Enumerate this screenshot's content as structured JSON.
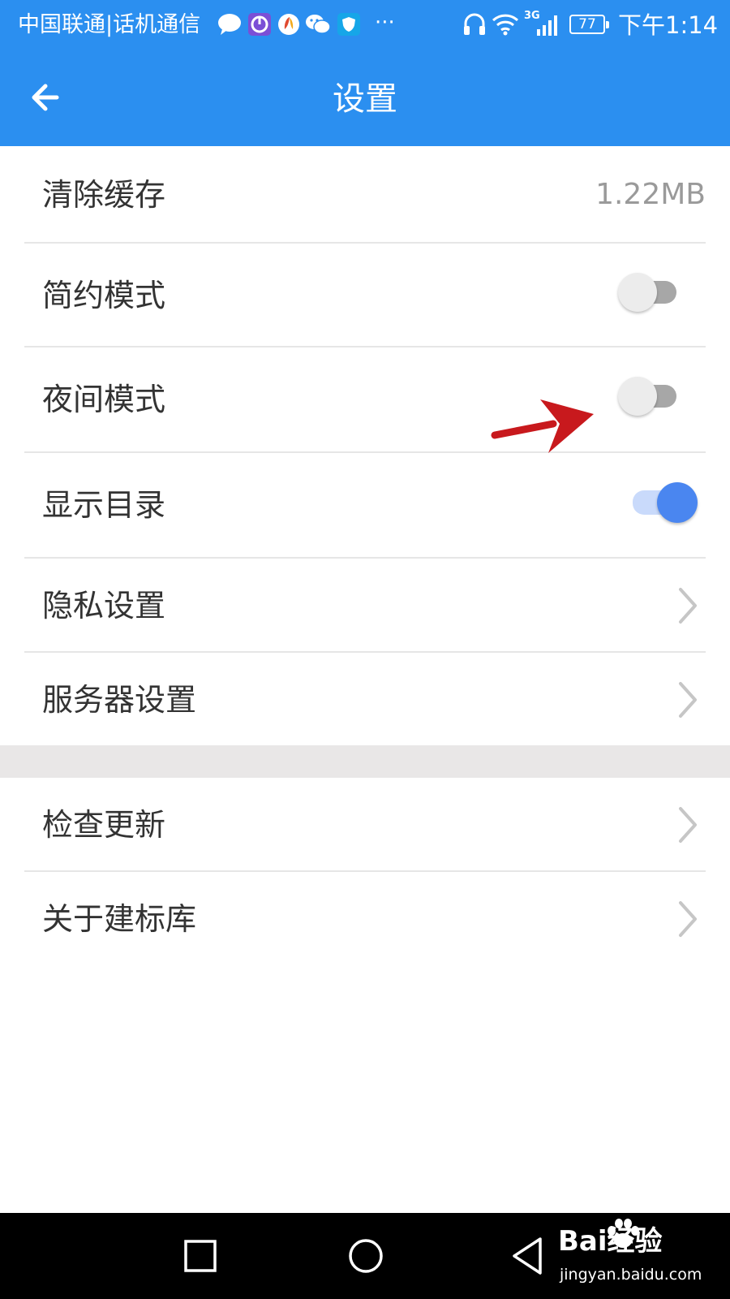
{
  "status_bar": {
    "carrier": "中国联通|话机通信",
    "more_indicator": "···",
    "network_type": "3G",
    "battery_level": "77",
    "time": "下午1:14",
    "notification_icons": [
      "message-icon",
      "meter-app-icon",
      "leaf-app-icon",
      "wechat-icon",
      "shield-icon"
    ],
    "status_icons": [
      "headset-icon",
      "wifi-icon",
      "signal-icon",
      "battery-icon"
    ]
  },
  "app_bar": {
    "title": "设置",
    "back_icon": "back-arrow-icon"
  },
  "settings": {
    "clear_cache": {
      "label": "清除缓存",
      "value": "1.22MB"
    },
    "simple_mode": {
      "label": "简约模式",
      "enabled": false
    },
    "night_mode": {
      "label": "夜间模式",
      "enabled": false
    },
    "show_catalog": {
      "label": "显示目录",
      "enabled": true
    },
    "privacy": {
      "label": "隐私设置"
    },
    "server": {
      "label": "服务器设置"
    },
    "check_update": {
      "label": "检查更新"
    },
    "about": {
      "label": "关于建标库"
    }
  },
  "annotation": {
    "icon": "red-arrow-icon",
    "color": "#c8191d"
  },
  "nav_bar": {
    "buttons": [
      "recent-apps-icon",
      "home-icon",
      "back-triangle-icon"
    ]
  },
  "watermark": {
    "brand": "Bai经验",
    "url": "jingyan.baidu.com"
  },
  "colors": {
    "primary": "#2b8ff0",
    "toggle_on": "#4a86f0",
    "toggle_on_track": "#c9dafb",
    "toggle_off_knob": "#ececec",
    "toggle_off_track": "#a7a7a7",
    "divider": "#e6e6e6",
    "section_gap": "#e9e7e7"
  }
}
